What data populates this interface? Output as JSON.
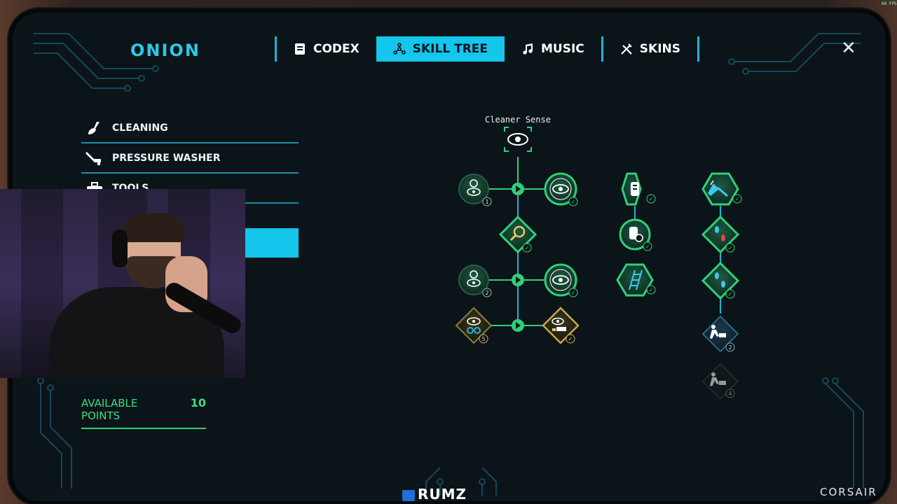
{
  "app": {
    "logo_text": "ONION"
  },
  "tabs": [
    {
      "label": "CODEX",
      "icon": "book-icon",
      "active": false
    },
    {
      "label": "SKILL TREE",
      "icon": "tree-icon",
      "active": true
    },
    {
      "label": "MUSIC",
      "icon": "music-note-icon",
      "active": false
    },
    {
      "label": "SKINS",
      "icon": "crossed-tools-icon",
      "active": false
    }
  ],
  "close_glyph": "✕",
  "categories": [
    {
      "label": "CLEANING",
      "icon": "broom-icon"
    },
    {
      "label": "PRESSURE WASHER",
      "icon": "spray-gun-icon"
    },
    {
      "label": "TOOLS",
      "icon": "toolbox-icon"
    }
  ],
  "available_points": {
    "label": "AVAILABLE POINTS",
    "value": "10"
  },
  "skill_tree": {
    "title": "Cleaner Sense",
    "nodes": [
      {
        "id": "cleaner-sense",
        "icon": "eye-icon"
      },
      {
        "id": "sense-timer-1",
        "icon": "eye-timer-icon",
        "badge": "1"
      },
      {
        "id": "sense-range-1",
        "icon": "eye-radar-icon",
        "badge": "✓"
      },
      {
        "id": "magnifier",
        "icon": "magnifier-icon",
        "badge": "✓"
      },
      {
        "id": "sense-timer-2",
        "icon": "eye-timer-icon",
        "badge": "2"
      },
      {
        "id": "sense-range-2",
        "icon": "eye-radar-icon",
        "badge": "✓"
      },
      {
        "id": "sense-infinite",
        "icon": "eye-infinity-icon",
        "badge": "5"
      },
      {
        "id": "sense-objects",
        "icon": "eye-objects-icon",
        "badge": "✓"
      },
      {
        "id": "washer-capacity",
        "icon": "tank-icon",
        "badge": "✓"
      },
      {
        "id": "washer-speed",
        "icon": "tank-timer-icon",
        "badge": "✓"
      },
      {
        "id": "ladder",
        "icon": "ladder-icon",
        "badge": "✓"
      },
      {
        "id": "scraper",
        "icon": "scraper-icon",
        "badge": "✓"
      },
      {
        "id": "footprints-red",
        "icon": "footprints-icon",
        "badge": "✓"
      },
      {
        "id": "footprints-blue",
        "icon": "footprints-icon",
        "badge": "✓"
      },
      {
        "id": "cart-push-2",
        "icon": "cart-push-icon",
        "badge": "2"
      },
      {
        "id": "cart-push-4",
        "icon": "cart-push-icon",
        "badge": "4"
      }
    ]
  },
  "overlay": {
    "channel_name": "RUMZ",
    "sponsor": "CORSAIR",
    "fps": "60 FPS"
  },
  "colors": {
    "accent": "#14c6ec",
    "points": "#3cdc84",
    "node_green": "#2fd07a",
    "panel_bg": "#0b1418"
  }
}
